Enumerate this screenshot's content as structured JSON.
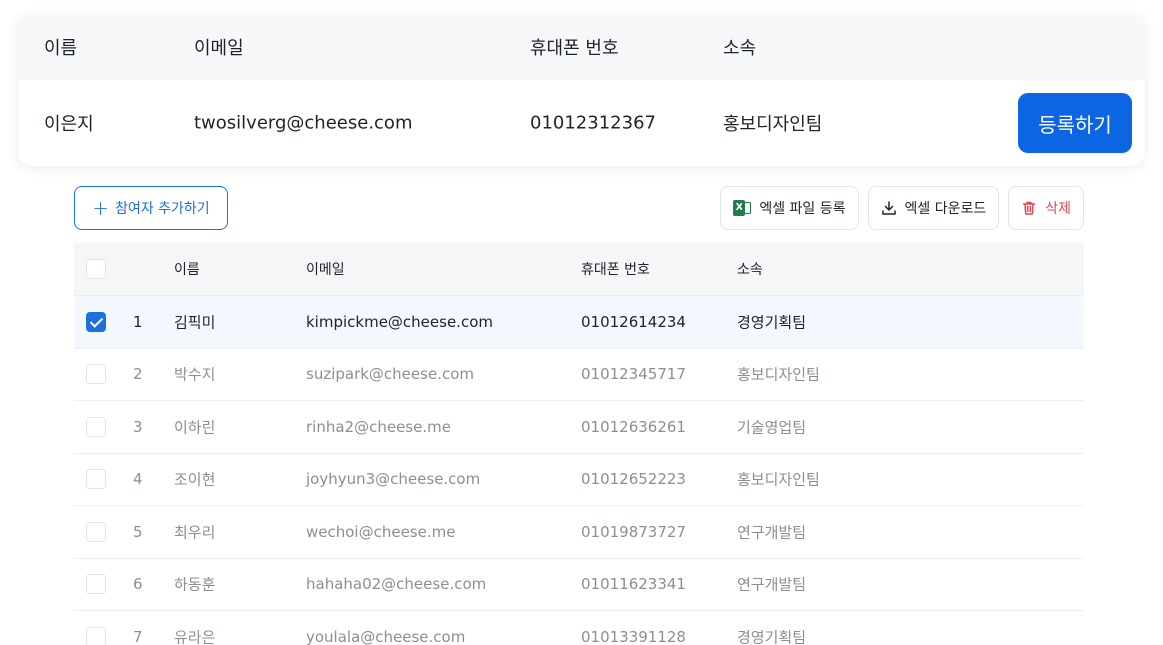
{
  "registration": {
    "headers": {
      "name": "이름",
      "email": "이메일",
      "phone": "휴대폰 번호",
      "org": "소속"
    },
    "entry": {
      "name": "이은지",
      "email": "twosilverg@cheese.com",
      "phone": "01012312367",
      "org": "홍보디자인팀"
    },
    "register_label": "등록하기"
  },
  "toolbar": {
    "add_label": "참여자 추가하기",
    "excel_upload_label": "엑셀 파일 등록",
    "excel_download_label": "엑셀 다운로드",
    "delete_label": "삭제"
  },
  "table": {
    "headers": {
      "name": "이름",
      "email": "이메일",
      "phone": "휴대폰 번호",
      "org": "소속"
    },
    "rows": [
      {
        "no": "1",
        "name": "김픽미",
        "email": "kimpickme@cheese.com",
        "phone": "01012614234",
        "org": "경영기획팀",
        "checked": true
      },
      {
        "no": "2",
        "name": "박수지",
        "email": "suzipark@cheese.com",
        "phone": "01012345717",
        "org": "홍보디자인팀",
        "checked": false
      },
      {
        "no": "3",
        "name": "이하린",
        "email": "rinha2@cheese.me",
        "phone": "01012636261",
        "org": "기술영업팀",
        "checked": false
      },
      {
        "no": "4",
        "name": "조이현",
        "email": "joyhyun3@cheese.com",
        "phone": "01012652223",
        "org": "홍보디자인팀",
        "checked": false
      },
      {
        "no": "5",
        "name": "최우리",
        "email": "wechoi@cheese.me",
        "phone": "01019873727",
        "org": "연구개발팀",
        "checked": false
      },
      {
        "no": "6",
        "name": "하동훈",
        "email": "hahaha02@cheese.com",
        "phone": "01011623341",
        "org": "연구개발팀",
        "checked": false
      },
      {
        "no": "7",
        "name": "유라은",
        "email": "youlala@cheese.com",
        "phone": "01013391128",
        "org": "경영기획팀",
        "checked": false
      }
    ]
  },
  "colors": {
    "accent": "#0c66e4",
    "danger": "#e5484d",
    "excel": "#1e7e45"
  }
}
